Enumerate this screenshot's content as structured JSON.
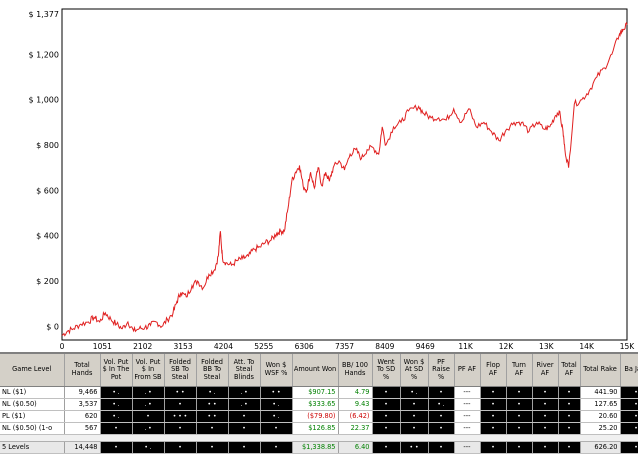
{
  "chart_data": {
    "type": "line",
    "x_ticks": [
      "0",
      "1051",
      "2102",
      "3153",
      "4204",
      "5255",
      "6306",
      "7357",
      "8409",
      "9469",
      "11K",
      "12K",
      "13K",
      "14K",
      "15K"
    ],
    "y_ticks": [
      "$ 0",
      "$ 200",
      "$ 400",
      "$ 600",
      "$ 800",
      "$ 1,000",
      "$ 1,200",
      "$ 1,377"
    ],
    "xlim": [
      0,
      15000
    ],
    "ylim": [
      -60,
      1400
    ],
    "grid": true,
    "line_color": "#e02020",
    "x": [
      0,
      150,
      300,
      500,
      700,
      850,
      1000,
      1150,
      1300,
      1450,
      1600,
      1750,
      1900,
      2050,
      2200,
      2350,
      2500,
      2650,
      2800,
      2950,
      3050,
      3153,
      3300,
      3450,
      3600,
      3750,
      3900,
      4050,
      4150,
      4204,
      4260,
      4350,
      4500,
      4650,
      4800,
      4950,
      5100,
      5255,
      5400,
      5550,
      5700,
      5800,
      5900,
      6000,
      6100,
      6200,
      6306,
      6400,
      6500,
      6600,
      6700,
      6800,
      6900,
      7000,
      7100,
      7200,
      7357,
      7500,
      7650,
      7800,
      7950,
      8100,
      8250,
      8409,
      8500,
      8600,
      8800,
      9000,
      9200,
      9469,
      9600,
      9800,
      10000,
      10200,
      10400,
      10600,
      10800,
      11000,
      11200,
      11400,
      11600,
      11800,
      12000,
      12200,
      12400,
      12600,
      12800,
      12950,
      13100,
      13200,
      13300,
      13350,
      13450,
      13600,
      13800,
      14000,
      14200,
      14400,
      14600,
      14800,
      14900,
      15000
    ],
    "y": [
      -40,
      -20,
      -10,
      10,
      20,
      40,
      20,
      60,
      30,
      10,
      -10,
      20,
      -20,
      -10,
      -5,
      5,
      20,
      0,
      30,
      60,
      110,
      150,
      130,
      180,
      200,
      170,
      230,
      250,
      310,
      420,
      300,
      280,
      270,
      290,
      300,
      310,
      340,
      350,
      370,
      380,
      410,
      420,
      420,
      520,
      640,
      680,
      710,
      620,
      600,
      680,
      610,
      700,
      620,
      680,
      640,
      700,
      730,
      690,
      760,
      780,
      740,
      780,
      790,
      760,
      880,
      800,
      880,
      900,
      950,
      970,
      940,
      920,
      920,
      910,
      960,
      900,
      960,
      880,
      900,
      860,
      820,
      870,
      900,
      900,
      860,
      900,
      870,
      880,
      930,
      950,
      860,
      780,
      700,
      980,
      1000,
      1040,
      1100,
      1140,
      1200,
      1290,
      1310,
      1330,
      1377
    ]
  },
  "table": {
    "headers": [
      "Game Level",
      "Total Hands",
      "Vol. Put $ In The Pot",
      "Vol. Put $ In From SB",
      "Folded SB To Steal",
      "Folded BB To Steal",
      "Att. To Steal Blinds",
      "Won $ WSF %",
      "Amount Won",
      "BB/ 100 Hands",
      "Went To SD %",
      "Won $ At SD %",
      "PF Raise %",
      "PF AF",
      "Flop AF",
      "Turn AF",
      "River AF",
      "Total AF",
      "Total Rake",
      "Ba Ja C"
    ],
    "rows": [
      {
        "level": "NL ($1)",
        "hands": "9,466",
        "won": "$907.15",
        "bb100": "4.79",
        "rake": "441.90"
      },
      {
        "level": "NL ($0.50)",
        "hands": "3,537",
        "won": "$333.65",
        "bb100": "9.43",
        "rake": "127.65"
      },
      {
        "level": "PL ($1)",
        "hands": "620",
        "won": "($79.80)",
        "bb100": "(6.42)",
        "rake": "20.60"
      },
      {
        "level": "NL ($0.50) (1-o",
        "hands": "567",
        "won": "$126.85",
        "bb100": "22.37",
        "rake": "25.20"
      }
    ],
    "total": {
      "level": "5 Levels",
      "hands": "14,448",
      "won": "$1,338.85",
      "bb100": "6.40",
      "rake": "626.20"
    },
    "pf_af_placeholder": "---"
  }
}
